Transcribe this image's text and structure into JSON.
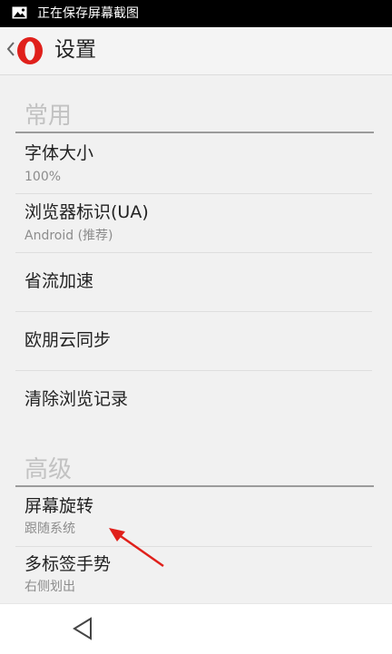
{
  "status_bar": {
    "notification": "正在保存屏幕截图",
    "icon": "image-icon"
  },
  "app_bar": {
    "title": "设置",
    "logo": "opera-logo",
    "back_icon": "chevron-left-icon"
  },
  "sections": [
    {
      "header": "常用",
      "items": [
        {
          "title": "字体大小",
          "subtitle": "100%"
        },
        {
          "title": "浏览器标识(UA)",
          "subtitle": "Android (推荐)"
        },
        {
          "title": "省流加速"
        },
        {
          "title": "欧朋云同步"
        },
        {
          "title": "清除浏览记录"
        }
      ]
    },
    {
      "header": "高级",
      "items": [
        {
          "title": "屏幕旋转",
          "subtitle": "跟随系统"
        },
        {
          "title": "多标签手势",
          "subtitle": "右侧划出"
        }
      ]
    }
  ],
  "nav_bar": {
    "back_icon": "triangle-back-icon"
  },
  "colors": {
    "accent_red": "#e0201b",
    "status_bar": "#000000",
    "section_text": "#c2c2c2"
  }
}
